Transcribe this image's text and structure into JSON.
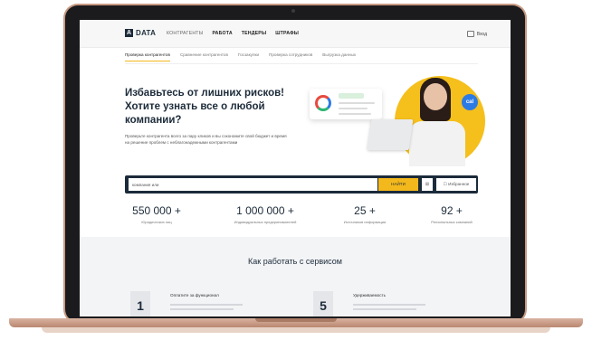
{
  "header": {
    "logo_mark": "A",
    "logo_text": "DATA",
    "nav": [
      "КОНТРАГЕНТЫ",
      "РАБОТА",
      "ТЕНДЕРЫ",
      "ШТРАФЫ"
    ],
    "login": "Вход"
  },
  "subnav": [
    "Проверка контрагентов",
    "Сравнение контрагентов",
    "Госзакупки",
    "Проверка сотрудников",
    "Выгрузка данных"
  ],
  "hero": {
    "title": "Избавьтесь от лишних рисков! Хотите узнать все о любой компании?",
    "description": "Проверьте контрагента всего за пару кликов и вы сэкономите свой бюджет и время на решение проблем с неблагонадежными контрагентами",
    "badge": "cal"
  },
  "search": {
    "placeholder": "компания или",
    "button": "НАЙТИ",
    "favorites": "Избранное"
  },
  "stats": [
    {
      "num": "550 000 +",
      "label": "Юридических лиц"
    },
    {
      "num": "1 000 000 +",
      "label": "Индивидуальных предпринимателей"
    },
    {
      "num": "25 +",
      "label": "Источников информации"
    },
    {
      "num": "92 +",
      "label": "Региональных компаний"
    }
  ],
  "how": {
    "title": "Как работать с сервисом",
    "steps": [
      {
        "num": "1",
        "title": "Оплатите за функционал"
      },
      {
        "num": "5",
        "title": "Удерживаемость"
      }
    ]
  },
  "colors": {
    "accent": "#f3b81b",
    "navy": "#1c2b3a",
    "frame": "#c79a84"
  }
}
